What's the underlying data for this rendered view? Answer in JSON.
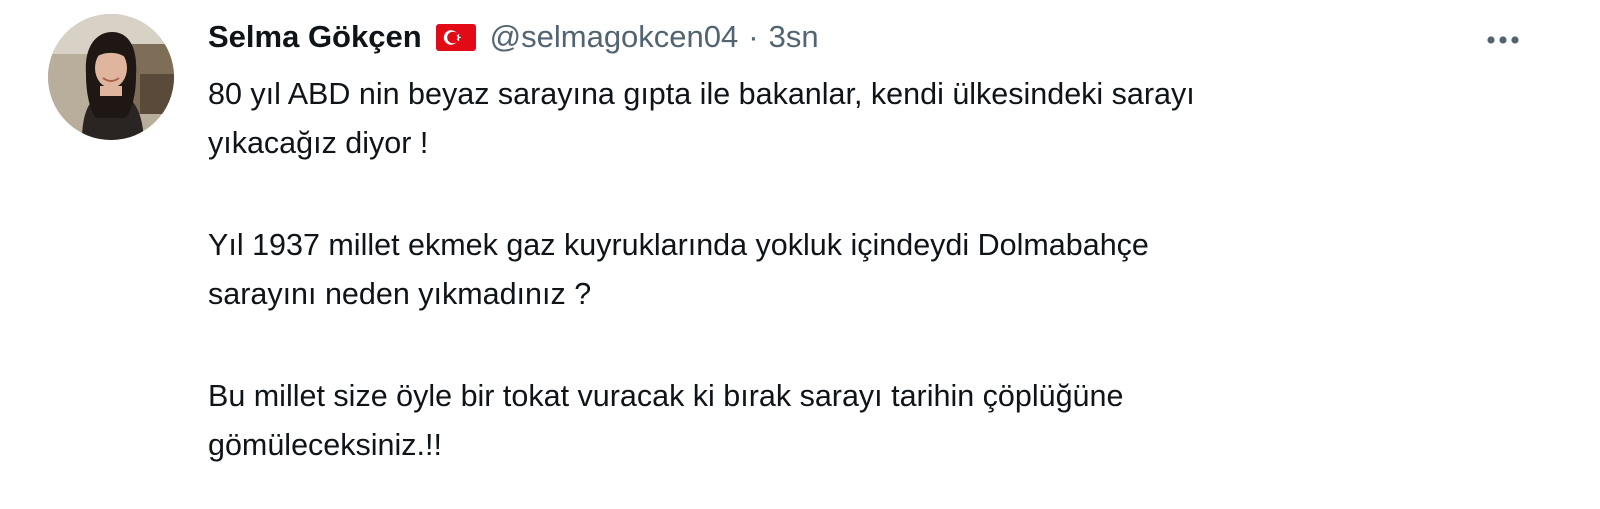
{
  "tweet": {
    "author": {
      "display_name": "Selma Gökçen",
      "flag_icon": "turkey-flag-icon",
      "handle": "@selmagokcen04",
      "separator": "·",
      "time": "3sn"
    },
    "more_icon": "more-horizontal-icon",
    "paragraphs": [
      {
        "lines": [
          "80 yıl ABD nin beyaz sarayına gıpta ile bakanlar, kendi ülkesindeki sarayı",
          "yıkacağız diyor !"
        ]
      },
      {
        "lines": [
          "Yıl 1937 millet ekmek gaz kuyruklarında yokluk içindeydi Dolmabahçe",
          "sarayını neden yıkmadınız ?"
        ]
      },
      {
        "lines": [
          "Bu millet size öyle bir tokat vuracak ki bırak sarayı tarihin çöplüğüne",
          "gömüleceksiniz.!!"
        ]
      }
    ]
  },
  "colors": {
    "text_primary": "#0f1419",
    "text_secondary": "#536471",
    "flag_red": "#e30a17",
    "background": "#ffffff"
  }
}
